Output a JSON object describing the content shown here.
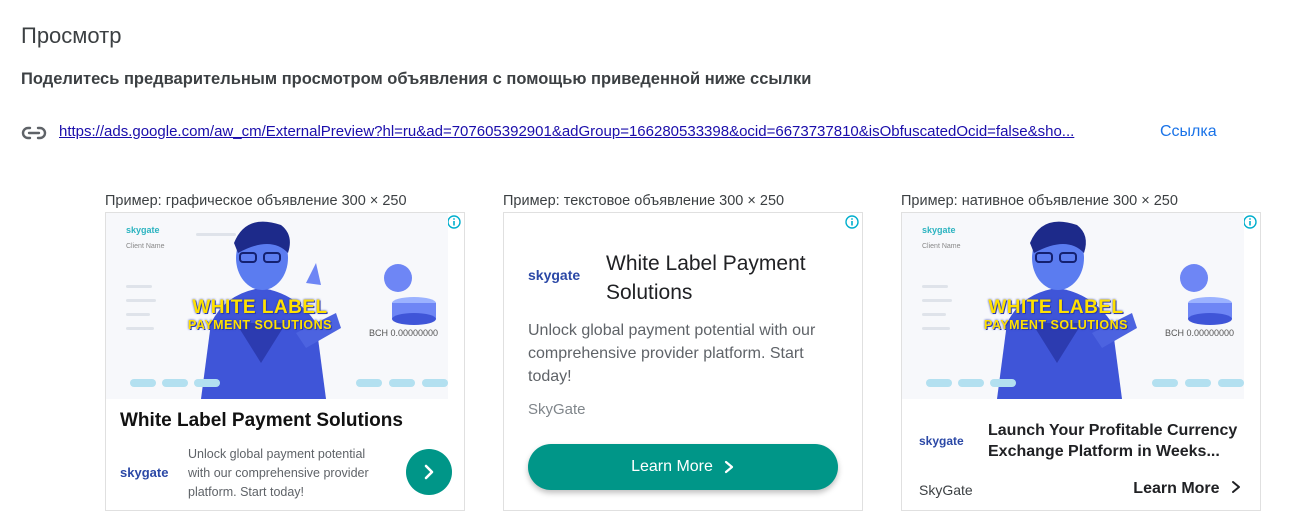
{
  "header": {
    "title": "Просмотр",
    "subtitle": "Поделитесь предварительным просмотром объявления с помощью приведенной ниже ссылки"
  },
  "share": {
    "url": "https://ads.google.com/aw_cm/ExternalPreview?hl=ru&ad=707605392901&adGroup=166280533398&ocid=6673737810&isObfuscatedOcid=false&sho...",
    "link_label": "Ссылка",
    "icon": "link-icon"
  },
  "ads": [
    {
      "caption": "Пример: графическое объявление 300 × 250",
      "image_banner_line1": "WHITE LABEL",
      "image_banner_line2": "PAYMENT SOLUTIONS",
      "image_mock_brand": "skygate",
      "image_mock_field": "Client Name",
      "image_mock_balance": "BCH 0.00000000",
      "title": "White Label Payment Solutions",
      "logo": "skygate",
      "description": "Unlock global payment potential with our comprehensive provider platform. Start today!",
      "cta_icon": "chevron-right-icon"
    },
    {
      "caption": "Пример: текстовое объявление 300 × 250",
      "logo": "skygate",
      "title": "White Label Payment Solutions",
      "description": "Unlock global payment potential with our comprehensive provider platform. Start today!",
      "brand": "SkyGate",
      "cta": "Learn More"
    },
    {
      "caption": "Пример: нативное объявление 300 × 250",
      "image_banner_line1": "WHITE LABEL",
      "image_banner_line2": "PAYMENT SOLUTIONS",
      "image_mock_brand": "skygate",
      "image_mock_field": "Client Name",
      "image_mock_balance": "BCH 0.00000000",
      "logo": "skygate",
      "title": "Launch Your Profitable Currency Exchange Platform in Weeks...",
      "brand": "SkyGate",
      "cta": "Learn More"
    }
  ],
  "colors": {
    "accent_teal": "#009688",
    "link_blue": "#1a0dab",
    "action_blue": "#1a73e8",
    "logo_blue": "#2b48a6"
  }
}
